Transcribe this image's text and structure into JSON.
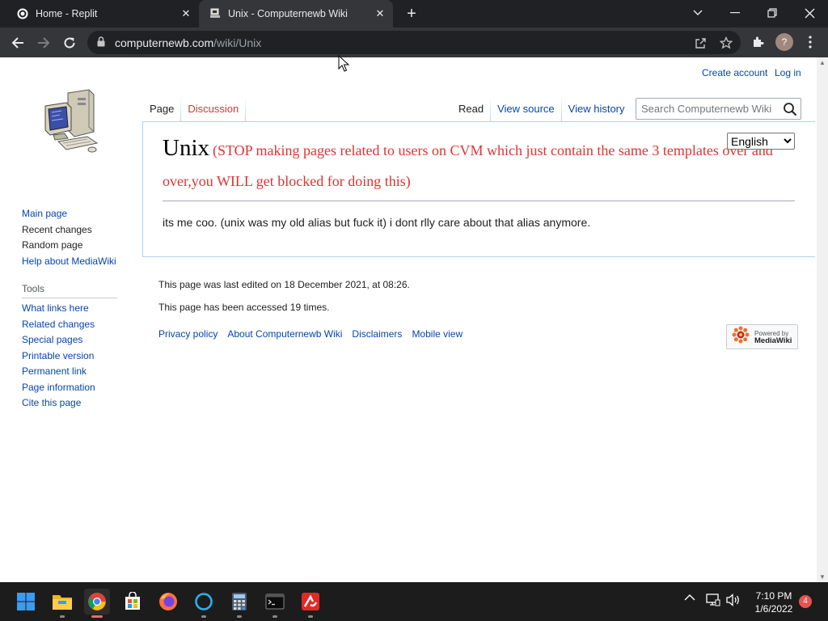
{
  "browser": {
    "tabs": [
      {
        "title": "Home - Replit",
        "favicon": "replit-icon"
      },
      {
        "title": "Unix - Computernewb Wiki",
        "favicon": "wiki-icon"
      }
    ],
    "url": {
      "host": "computernewb.com",
      "path": "/wiki/Unix"
    },
    "profile_initial": "?"
  },
  "personal": {
    "create_account": "Create account",
    "log_in": "Log in"
  },
  "tabs_left": [
    {
      "label": "Page"
    },
    {
      "label": "Discussion"
    }
  ],
  "tabs_right": [
    {
      "label": "Read"
    },
    {
      "label": "View source"
    },
    {
      "label": "View history"
    }
  ],
  "search": {
    "placeholder": "Search Computernewb Wiki"
  },
  "nav": [
    {
      "label": "Main page"
    },
    {
      "label": "Recent changes"
    },
    {
      "label": "Random page"
    },
    {
      "label": "Help about MediaWiki"
    }
  ],
  "tools": {
    "heading": "Tools",
    "items": [
      {
        "label": "What links here"
      },
      {
        "label": "Related changes"
      },
      {
        "label": "Special pages"
      },
      {
        "label": "Printable version"
      },
      {
        "label": "Permanent link"
      },
      {
        "label": "Page information"
      },
      {
        "label": "Cite this page"
      }
    ]
  },
  "article": {
    "title": "Unix",
    "warning": "(STOP making pages related to users on CVM which just contain the same 3 templates over and over,you WILL get blocked for doing this)",
    "language": "English",
    "body": "its me coo. (unix was my old alias but fuck it) i dont rlly care about that alias anymore."
  },
  "footer": {
    "last_edited": "This page was last edited on 18 December 2021, at 08:26.",
    "accessed": "This page has been accessed 19 times.",
    "links": [
      {
        "label": "Privacy policy"
      },
      {
        "label": "About Computernewb Wiki"
      },
      {
        "label": "Disclaimers"
      },
      {
        "label": "Mobile view"
      }
    ],
    "powered_by": {
      "line1": "Powered by",
      "line2": "MediaWiki"
    }
  },
  "taskbar": {
    "apps": [
      "start-icon",
      "file-explorer-icon",
      "chrome-icon",
      "store-icon",
      "firefox-icon",
      "cortana-icon",
      "calculator-icon",
      "terminal-icon",
      "avira-icon"
    ],
    "time": "7:10 PM",
    "date": "1/6/2022",
    "notifications": "4"
  },
  "colors": {
    "link": "#0645ad",
    "new_link": "#dd3333",
    "tab_border": "#a7d7f9",
    "chrome_dark": "#202124",
    "chrome_toolbar": "#35363a"
  }
}
